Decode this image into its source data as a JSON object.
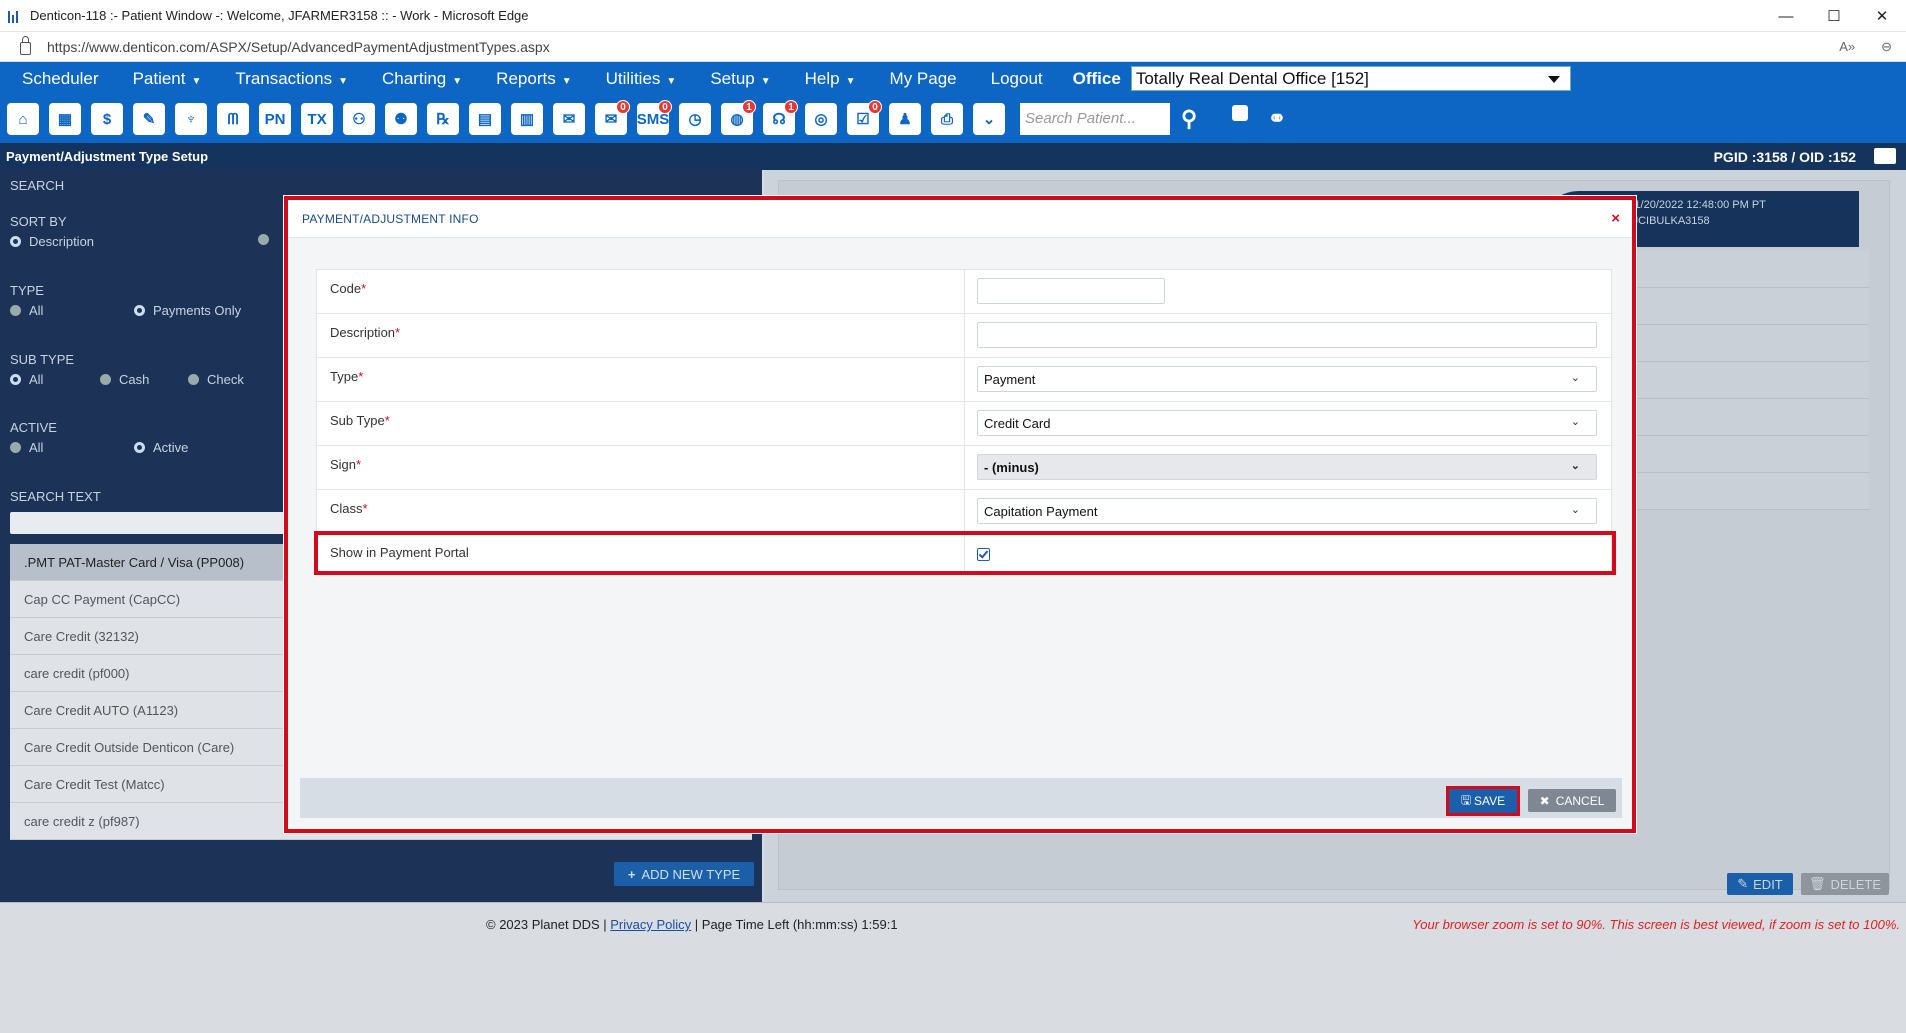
{
  "window": {
    "title": "Denticon-118 :- Patient Window -: Welcome, JFARMER3158 :: - Work - Microsoft Edge",
    "controls": [
      "—",
      "☐",
      "✕"
    ]
  },
  "browser": {
    "url": "https://www.denticon.com/ASPX/Setup/AdvancedPaymentAdjustmentTypes.aspx",
    "read_aloud": "A»",
    "zoom_glyph": "⊖"
  },
  "nav": {
    "items": [
      {
        "label": "Scheduler",
        "caret": ""
      },
      {
        "label": "Patient",
        "caret": "▼"
      },
      {
        "label": "Transactions",
        "caret": "▼"
      },
      {
        "label": "Charting",
        "caret": "▼"
      },
      {
        "label": "Reports",
        "caret": "▼"
      },
      {
        "label": "Utilities",
        "caret": "▼"
      },
      {
        "label": "Setup",
        "caret": "▼"
      },
      {
        "label": "Help",
        "caret": "▼"
      },
      {
        "label": "My Page",
        "caret": ""
      },
      {
        "label": "Logout",
        "caret": ""
      }
    ],
    "office_label": "Office",
    "office_value": "Totally Real Dental Office [152]"
  },
  "toolbar": {
    "icons": [
      {
        "name": "home-icon",
        "glyph": "⌂",
        "badge": ""
      },
      {
        "name": "calendar-icon",
        "glyph": "▦",
        "badge": ""
      },
      {
        "name": "dollar-icon",
        "glyph": "$",
        "badge": ""
      },
      {
        "name": "edit-list-icon",
        "glyph": "✎",
        "badge": ""
      },
      {
        "name": "tooth-icon",
        "glyph": "♆",
        "badge": ""
      },
      {
        "name": "tooth-roots-icon",
        "glyph": "ᗰ",
        "badge": ""
      },
      {
        "name": "pn-icon",
        "glyph": "PN",
        "badge": ""
      },
      {
        "name": "tx-icon",
        "glyph": "TX",
        "badge": ""
      },
      {
        "name": "add-patient-icon",
        "glyph": "⚇",
        "badge": ""
      },
      {
        "name": "add-user-icon",
        "glyph": "⚉",
        "badge": ""
      },
      {
        "name": "rx-icon",
        "glyph": "℞",
        "badge": ""
      },
      {
        "name": "notes-icon",
        "glyph": "▤",
        "badge": ""
      },
      {
        "name": "print-doc-icon",
        "glyph": "▥",
        "badge": ""
      },
      {
        "name": "mail-icon",
        "glyph": "✉",
        "badge": ""
      },
      {
        "name": "chat-icon",
        "glyph": "✉",
        "badge": "0"
      },
      {
        "name": "sms-icon",
        "glyph": "SMS",
        "badge": "0"
      },
      {
        "name": "clock-icon",
        "glyph": "◷",
        "badge": ""
      },
      {
        "name": "globe-alert-icon",
        "glyph": "◍",
        "badge": "1"
      },
      {
        "name": "support-icon",
        "glyph": "☊",
        "badge": "1"
      },
      {
        "name": "web-icon",
        "glyph": "◎",
        "badge": ""
      },
      {
        "name": "forms-icon",
        "glyph": "☑",
        "badge": "0"
      },
      {
        "name": "family-icon",
        "glyph": "♟",
        "badge": ""
      },
      {
        "name": "printer-icon",
        "glyph": "⎙",
        "badge": ""
      },
      {
        "name": "expand-icon",
        "glyph": "⌄",
        "badge": ""
      }
    ],
    "search_placeholder": "Search Patient...",
    "search_user_glyph": "⚲",
    "group_search_glyph": "⚭"
  },
  "page_header": {
    "title": "Payment/Adjustment Type Setup",
    "ids": "PGID :3158 / OID :152"
  },
  "left": {
    "search_header": "SEARCH",
    "sort_by_label": "SORT BY",
    "sort_description": "Description",
    "type_label": "TYPE",
    "type_all": "All",
    "type_payments_only": "Payments Only",
    "sub_type_label": "SUB TYPE",
    "sub_all": "All",
    "sub_cash": "Cash",
    "sub_check": "Check",
    "active_label": "ACTIVE",
    "active_all": "All",
    "active_active": "Active",
    "search_text_label": "SEARCH TEXT",
    "list": [
      ".PMT PAT-Master Card / Visa (PP008)",
      "Cap CC Payment (CapCC)",
      "Care Credit (32132)",
      "care credit (pf000)",
      "Care Credit AUTO (A1123)",
      "Care Credit Outside Denticon (Care)",
      "Care Credit Test (Matcc)",
      "care credit z (pf987)"
    ],
    "add_new_type": "ADD NEW TYPE"
  },
  "right": {
    "modified_on": "Modified On: 1/20/2022 12:48:00 PM PT",
    "modified_by": "Modified By: JCIBULKA3158",
    "edit": "EDIT",
    "delete": "DELETE"
  },
  "dialog": {
    "title": "PAYMENT/ADJUSTMENT INFO",
    "close": "×",
    "fields": {
      "code_label": "Code",
      "code_value": "",
      "description_label": "Description",
      "description_value": "",
      "type_label": "Type",
      "type_value": "Payment",
      "subtype_label": "Sub Type",
      "subtype_value": "Credit Card",
      "sign_label": "Sign",
      "sign_value": "- (minus)",
      "class_label": "Class",
      "class_value": "Capitation Payment",
      "portal_label": "Show in Payment Portal",
      "portal_checked": true
    },
    "required_mark": "*",
    "save": "SAVE",
    "cancel": "CANCEL"
  },
  "footer": {
    "copyright": "© 2023 Planet DDS | ",
    "privacy": "Privacy Policy",
    "time_left": " |  Page Time Left (hh:mm:ss) 1:59:1",
    "zoom_warning": "Your browser zoom is set to 90%. This screen is best viewed, if zoom is set to 100%."
  },
  "colors": {
    "nav_blue": "#0d66c3",
    "header_dark": "#14345e",
    "highlight_red": "#d20b1c"
  }
}
